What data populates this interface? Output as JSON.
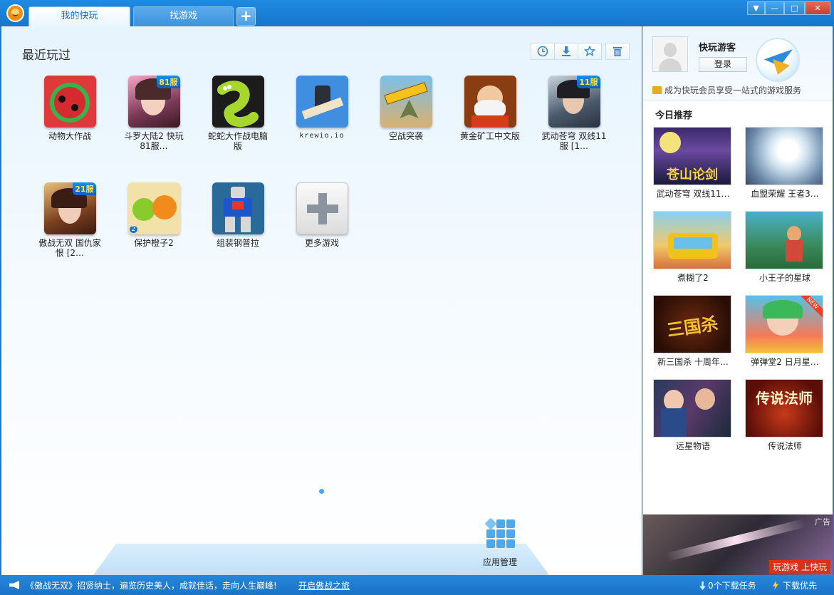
{
  "tabs": [
    {
      "label": "我的快玩",
      "active": true
    },
    {
      "label": "找游戏",
      "active": false
    }
  ],
  "tab_add_label": "+",
  "window_controls": {
    "menu": "▼",
    "minimize": "—",
    "maximize": "□",
    "close": "✕"
  },
  "recent": {
    "title": "最近玩过",
    "games": [
      {
        "name": "动物大作战",
        "badge": ""
      },
      {
        "name": "斗罗大陆2 快玩81服…",
        "badge": "81服"
      },
      {
        "name": "蛇蛇大作战电脑版",
        "badge": ""
      },
      {
        "name": "krewio.io",
        "badge": ""
      },
      {
        "name": "空战突袭",
        "badge": ""
      },
      {
        "name": "黄金矿工中文版",
        "badge": ""
      },
      {
        "name": "武动苍穹 双线11服 [1…",
        "badge": "11服"
      },
      {
        "name": "傲战无双 国仇家恨 [2…",
        "badge": "21服"
      },
      {
        "name": "保护橙子2",
        "badge": "2"
      },
      {
        "name": "组装钢普拉",
        "badge": ""
      },
      {
        "name": "更多游戏",
        "badge": ""
      }
    ]
  },
  "app_manager_label": "应用管理",
  "user": {
    "name": "快玩游客",
    "login_label": "登录",
    "vip_text": "成为快玩会员享受一站式的游戏服务"
  },
  "today": {
    "title": "今日推荐",
    "items": [
      {
        "caption": "武动苍穹 双线11…",
        "img_text": "苍山论剑"
      },
      {
        "caption": "血盟荣耀 王者3…",
        "img_text": ""
      },
      {
        "caption": "煮糊了2",
        "img_text": ""
      },
      {
        "caption": "小王子的星球",
        "img_text": ""
      },
      {
        "caption": "新三国杀 十周年…",
        "img_text": "三国杀"
      },
      {
        "caption": "弹弹堂2 日月星…",
        "img_text": "NEW"
      },
      {
        "caption": "远星物语",
        "img_text": ""
      },
      {
        "caption": "传说法师",
        "img_text": "传说法师"
      }
    ]
  },
  "ad": {
    "tag": "广告",
    "label": "玩游戏 上快玩"
  },
  "status": {
    "message": "《傲战无双》招贤纳士，遍览历史美人，成就佳话，走向人生巅峰!",
    "link": "开启傲战之旅",
    "downloads": "0个下载任务",
    "priority": "下载优先"
  },
  "colors": {
    "accent": "#1a7bd2",
    "badge": "#1c8fe8",
    "ad_label": "#d8321c"
  }
}
